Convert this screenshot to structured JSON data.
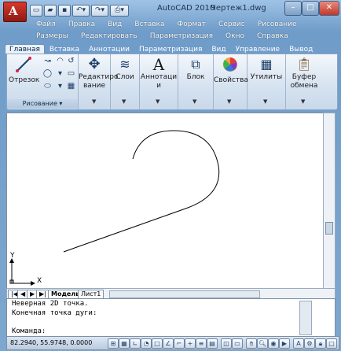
{
  "app": {
    "title": "AutoCAD 2010",
    "document": "Чертеж1.dwg",
    "logo_letter": "A"
  },
  "quick_access": [
    "new-icon",
    "open-icon",
    "save-icon",
    "undo-icon",
    "redo-icon",
    "plot-icon"
  ],
  "menubar": {
    "row1": [
      "Файл",
      "Правка",
      "Вид",
      "Вставка",
      "Формат",
      "Сервис",
      "Рисование"
    ],
    "row2": [
      "Размеры",
      "Редактировать",
      "Параметризация",
      "Окно",
      "Справка"
    ]
  },
  "ribbon_tabs": [
    "Главная",
    "Вставка",
    "Аннотации",
    "Параметризация",
    "Вид",
    "Управление",
    "Вывод"
  ],
  "active_tab": "Главная",
  "ribbon": {
    "line_label": "Отрезок",
    "modify_label": "Редактиро вание",
    "layers_label": "Слои",
    "annotation_label": "Аннотаци и",
    "block_label": "Блок",
    "properties_label": "Свойства",
    "utilities_label": "Утилиты",
    "clipboard_label": "Буфер обмена",
    "draw_panel": "Рисование ▾"
  },
  "canvas": {
    "y_axis": "Y",
    "x_axis": "X",
    "background": "#ffffff",
    "stroke": "#000000"
  },
  "layout_tabs": [
    "Модель",
    "Лист1"
  ],
  "command_lines": [
    "Неверная 2D точка.",
    "Конечная точка дуги:",
    "Команда:"
  ],
  "status": {
    "coords": "82.2940, 55.9748, 0.0000"
  },
  "colors": {
    "accent": "#6f9cc9",
    "logo": "#c7332a"
  }
}
